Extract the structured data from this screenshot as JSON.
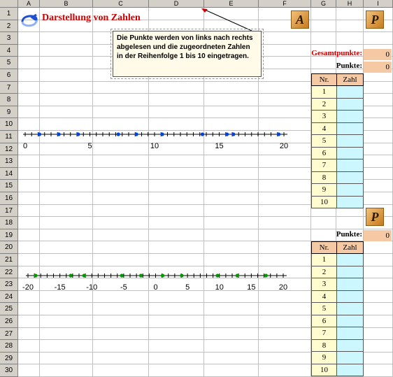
{
  "columns": [
    "A",
    "B",
    "C",
    "D",
    "E",
    "F",
    "G",
    "H",
    "I"
  ],
  "rows": [
    "1",
    "2",
    "3",
    "4",
    "5",
    "6",
    "7",
    "8",
    "9",
    "10",
    "11",
    "12",
    "13",
    "14",
    "15",
    "16",
    "17",
    "18",
    "19",
    "20",
    "21",
    "22",
    "23",
    "24",
    "25",
    "26",
    "27",
    "28",
    "29",
    "30"
  ],
  "title": "Darstellung von Zahlen",
  "buttons": {
    "a_label": "A",
    "p_label": "P",
    "p2_label": "P"
  },
  "note": "Die Punkte werden von links nach rechts abgelesen und die zugeordneten Zahlen in der Reihenfolge 1 bis 10 eingetragen.",
  "scores": {
    "gesamt_label": "Gesamtpunkte:",
    "gesamt_value": "0",
    "punkte_label": "Punkte:",
    "punkte_value": "0",
    "punkte2_label": "Punkte:",
    "punkte2_value": "0"
  },
  "table1": {
    "header_nr": "Nr.",
    "header_zahl": "Zahl",
    "rows": [
      "1",
      "2",
      "3",
      "4",
      "5",
      "6",
      "7",
      "8",
      "9",
      "10"
    ]
  },
  "table2": {
    "header_nr": "Nr.",
    "header_zahl": "Zahl",
    "rows": [
      "1",
      "2",
      "3",
      "4",
      "5",
      "6",
      "7",
      "8",
      "9",
      "10"
    ]
  },
  "line1": {
    "min": 0,
    "max": 20,
    "step": 0.5,
    "labels": [
      "0",
      "5",
      "10",
      "15",
      "20"
    ],
    "label_values": [
      0,
      5,
      10,
      15,
      20
    ],
    "points": [
      1.1,
      2.6,
      4.1,
      7.2,
      8.6,
      10.6,
      13.7,
      15.6,
      16.1,
      19.6
    ],
    "point_color": "#0044dd"
  },
  "line2": {
    "min": -20,
    "max": 20,
    "step": 1,
    "labels": [
      "-20",
      "-15",
      "-10",
      "-5",
      "0",
      "5",
      "10",
      "15",
      "20"
    ],
    "label_values": [
      -20,
      -15,
      -10,
      -5,
      0,
      5,
      10,
      15,
      20
    ],
    "points": [
      -18.8,
      -13.3,
      -11.2,
      -5.3,
      -2.3,
      1.1,
      4.1,
      9.7,
      12.8,
      17.3
    ],
    "point_color": "#009900"
  }
}
